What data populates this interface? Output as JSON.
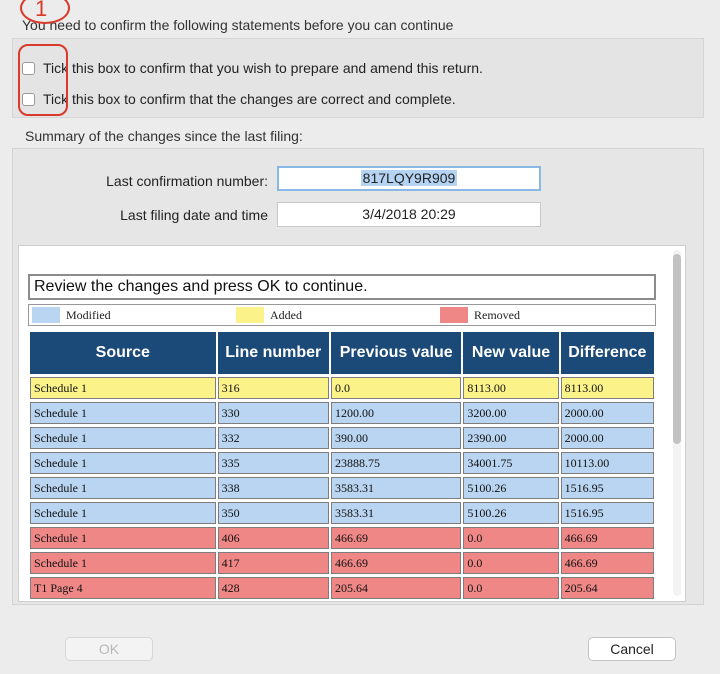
{
  "confirm": {
    "intro": "You need to confirm the following statements before you can continue",
    "checks": [
      "Tick this box to confirm that you wish to prepare and amend this return.",
      "Tick this box to confirm that the changes are correct and complete."
    ]
  },
  "annotation": {
    "number": "1",
    "color": "#d93a2b"
  },
  "summary": {
    "title": "Summary of the changes since the last filing:",
    "confirmation_label": "Last confirmation number:",
    "confirmation_value": "817LQY9R909",
    "filing_label": "Last filing date and time",
    "filing_value": "3/4/2018 20:29"
  },
  "report": {
    "instruction": "Review the changes and press OK to continue.",
    "legend": [
      {
        "label": "Modified",
        "color": "#b9d5f1"
      },
      {
        "label": "Added",
        "color": "#fbf28a"
      },
      {
        "label": "Removed",
        "color": "#f08787"
      }
    ],
    "columns": [
      "Source",
      "Line number",
      "Previous value",
      "New value",
      "Difference"
    ],
    "rows": [
      {
        "status": "added",
        "source": "Schedule 1",
        "line": "316",
        "previous": "0.0",
        "new": "8113.00",
        "difference": "8113.00"
      },
      {
        "status": "modified",
        "source": "Schedule 1",
        "line": "330",
        "previous": "1200.00",
        "new": "3200.00",
        "difference": "2000.00"
      },
      {
        "status": "modified",
        "source": "Schedule 1",
        "line": "332",
        "previous": "390.00",
        "new": "2390.00",
        "difference": "2000.00"
      },
      {
        "status": "modified",
        "source": "Schedule 1",
        "line": "335",
        "previous": "23888.75",
        "new": "34001.75",
        "difference": "10113.00"
      },
      {
        "status": "modified",
        "source": "Schedule 1",
        "line": "338",
        "previous": "3583.31",
        "new": "5100.26",
        "difference": "1516.95"
      },
      {
        "status": "modified",
        "source": "Schedule 1",
        "line": "350",
        "previous": "3583.31",
        "new": "5100.26",
        "difference": "1516.95"
      },
      {
        "status": "removed",
        "source": "Schedule 1",
        "line": "406",
        "previous": "466.69",
        "new": "0.0",
        "difference": "466.69"
      },
      {
        "status": "removed",
        "source": "Schedule 1",
        "line": "417",
        "previous": "466.69",
        "new": "0.0",
        "difference": "466.69"
      },
      {
        "status": "removed",
        "source": "T1 Page 4",
        "line": "428",
        "previous": "205.64",
        "new": "0.0",
        "difference": "205.64"
      }
    ]
  },
  "buttons": {
    "ok": "OK",
    "cancel": "Cancel"
  }
}
